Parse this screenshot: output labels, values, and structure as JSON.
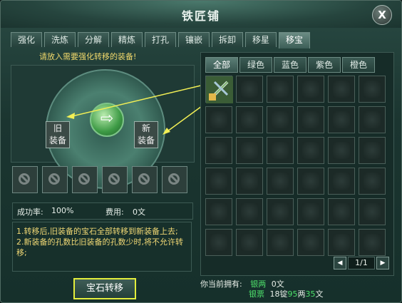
{
  "window": {
    "title": "铁匠铺",
    "close_label": "X"
  },
  "tabs": [
    "强化",
    "洗炼",
    "分解",
    "精炼",
    "打孔",
    "镶嵌",
    "拆卸",
    "移星",
    "移宝"
  ],
  "left": {
    "hint": "请放入需要强化转移的装备!",
    "old_slot": {
      "line1": "旧",
      "line2": "装备"
    },
    "new_slot": {
      "line1": "新",
      "line2": "装备"
    },
    "core_icon": "green-arrow",
    "stats": {
      "rate_label": "成功率:",
      "rate_value": "100%",
      "fee_label": "费用:",
      "fee_value": "0文"
    },
    "desc": "1.转移后,旧装备的宝石全部转移到新装备上去;\n2.新装备的孔数比旧装备的孔数少时,将不允许转移;"
  },
  "categories": [
    "全部",
    "绿色",
    "蓝色",
    "紫色",
    "橙色"
  ],
  "grid": {
    "rows": 6,
    "cols": 6,
    "first_item": "sword-item-icon"
  },
  "pager": {
    "text": "1/1"
  },
  "buttons": {
    "transfer": "宝石转移"
  },
  "money": {
    "label": "你当前拥有:",
    "silver_label": "银两",
    "silver_value": "0文",
    "note_label": "银票",
    "note_value_prefix": "18锭",
    "note_value_mid": "95",
    "note_value_mid_unit": "两",
    "note_value_end": "35",
    "note_value_end_unit": "文"
  },
  "colors": {
    "accent": "#efd774",
    "green": "#4ee06b",
    "highlight": "#e3ee3c"
  }
}
